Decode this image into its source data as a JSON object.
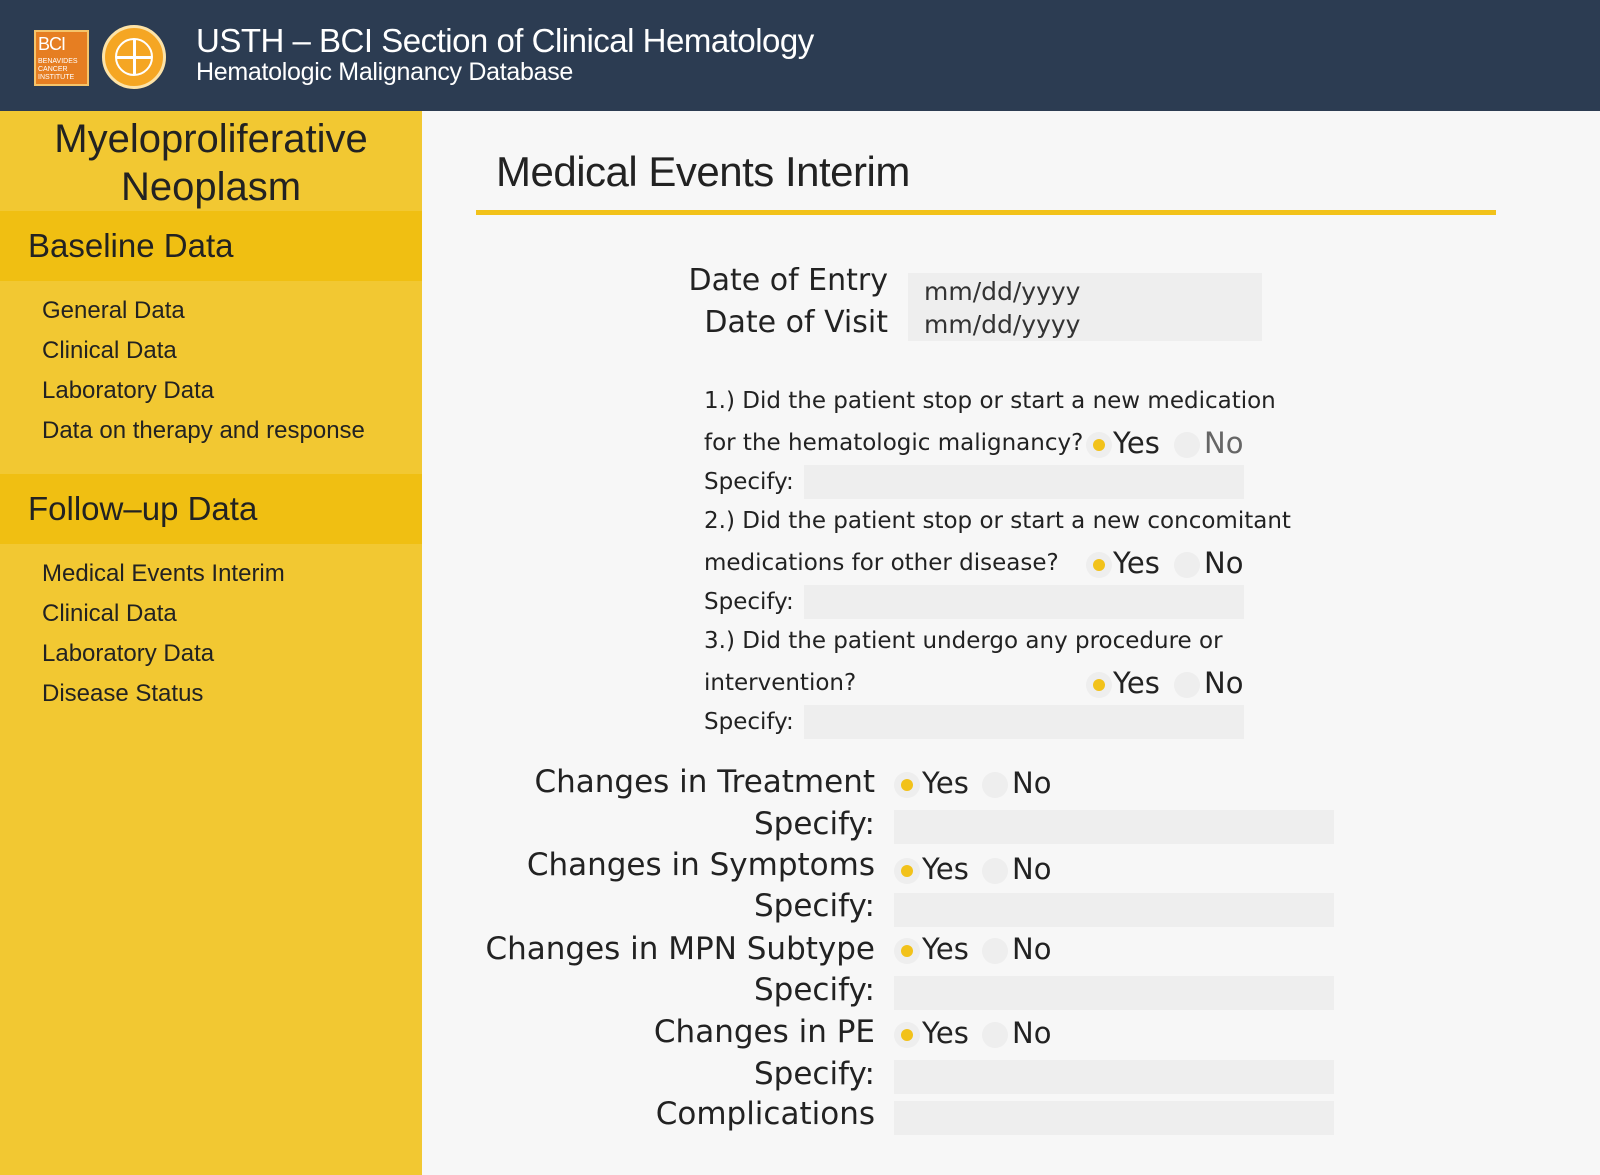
{
  "header": {
    "logo_text": "BCI",
    "logo_subtext": "BENAVIDES CANCER INSTITUTE",
    "title": "USTH – BCI Section of Clinical Hematology",
    "subtitle": "Hematologic Malignancy Database"
  },
  "sidebar": {
    "module_title_line1": "Myeloproliferative",
    "module_title_line2": "Neoplasm",
    "baseline": {
      "label": "Baseline Data",
      "items": [
        "General Data",
        "Clinical Data",
        "Laboratory Data",
        "Data on therapy and response"
      ]
    },
    "followup": {
      "label": "Follow–up Data",
      "items": [
        "Medical Events Interim",
        "Clinical Data",
        "Laboratory Data",
        "Disease Status"
      ]
    }
  },
  "main": {
    "title": "Medical Events Interim",
    "date_of_entry": {
      "label": "Date of Entry",
      "placeholder": "mm/dd/yyyy"
    },
    "date_of_visit": {
      "label": "Date of Visit",
      "placeholder": "mm/dd/yyyy"
    },
    "questions": [
      {
        "line1": "1.) Did the patient stop or start a new medication",
        "line2": "for the hematologic malignancy?",
        "selected": "Yes"
      },
      {
        "line1": "2.) Did the patient stop or start a new concomitant",
        "line2": "medications for other disease?",
        "selected": "Yes"
      },
      {
        "line1": "3.) Did the patient undergo any procedure or",
        "line2": "intervention?",
        "selected": "Yes"
      }
    ],
    "yes_label": "Yes",
    "no_label": "No",
    "specify_label": "Specify:",
    "changes": [
      {
        "label": "Changes in Treatment",
        "selected": "Yes"
      },
      {
        "label": "Changes in Symptoms",
        "selected": "Yes"
      },
      {
        "label": "Changes in MPN Subtype",
        "selected": "Yes"
      },
      {
        "label": "Changes in PE",
        "selected": "Yes"
      }
    ],
    "complications_label": "Complications"
  },
  "colors": {
    "header_bg": "#2c3c52",
    "sidebar_bg": "#f2c832",
    "section_bg": "#f0bf12",
    "accent": "#f2c21a"
  }
}
